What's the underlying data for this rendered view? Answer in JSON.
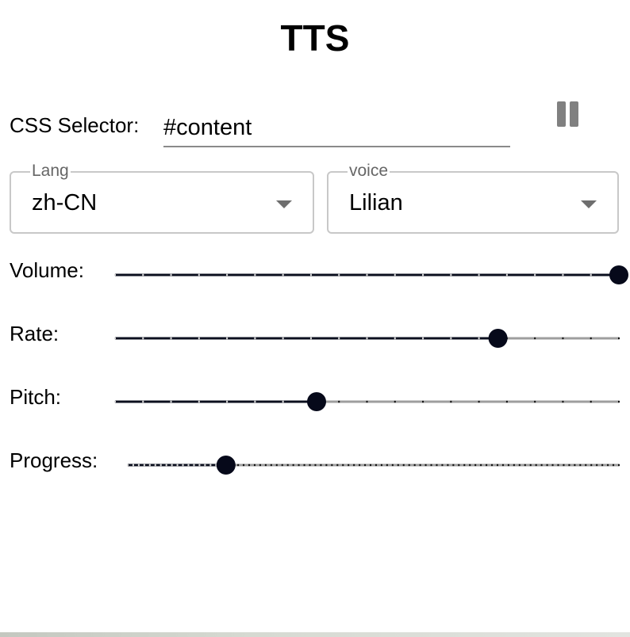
{
  "app": {
    "title": "TTS"
  },
  "selector": {
    "label": "CSS Selector:",
    "value": "#content",
    "pause_icon": "pause-icon"
  },
  "lang": {
    "legend": "Lang",
    "value": "zh-CN"
  },
  "voice": {
    "legend": "voice",
    "value": "Lilian"
  },
  "sliders": {
    "volume": {
      "label": "Volume:",
      "value": 1.0,
      "ticks": 19
    },
    "rate": {
      "label": "Rate:",
      "value": 0.76,
      "ticks": 19
    },
    "pitch": {
      "label": "Pitch:",
      "value": 0.4,
      "ticks": 19
    },
    "progress": {
      "label": "Progress:",
      "value": 0.2,
      "ticks": 90
    }
  },
  "colors": {
    "active_track": "#0b0f1e",
    "inactive_track": "#9e9e9e",
    "thumb": "#06091a",
    "tick_on_active": "#d8d8d8",
    "tick_on_inactive": "#111111"
  }
}
